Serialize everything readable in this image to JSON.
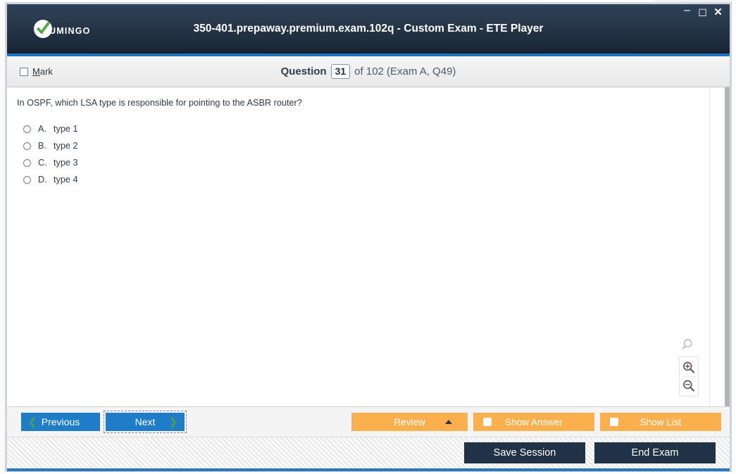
{
  "window": {
    "title": "350-401.prepaway.premium.exam.102q - Custom Exam - ETE Player",
    "controls": {
      "minimize": "–",
      "maximize": "☐",
      "close": "✕"
    }
  },
  "brand": {
    "name": "UMINGO",
    "check_color": "#4aa93a",
    "badge_color": "#ffffff"
  },
  "question_bar": {
    "mark_label_accel": "M",
    "mark_label_rest": "ark",
    "question_word": "Question",
    "question_number": "31",
    "rest": "of 102 (Exam A, Q49)"
  },
  "question": {
    "text": "In OSPF, which LSA type is responsible for pointing to the ASBR router?",
    "choices": [
      {
        "letter": "A.",
        "text": "type 1",
        "selected": false
      },
      {
        "letter": "B.",
        "text": "type 2",
        "selected": false
      },
      {
        "letter": "C.",
        "text": "type 3",
        "selected": false
      },
      {
        "letter": "D.",
        "text": "type 4",
        "selected": false
      }
    ]
  },
  "zoom_tools": {
    "search": "search-icon",
    "zoom_in": "zoom-in-icon",
    "zoom_out": "zoom-out-icon"
  },
  "toolbar": {
    "previous": "Previous",
    "next": "Next",
    "review": "Review",
    "show_answer": "Show Answer",
    "show_list": "Show List",
    "accent_blue": "#1f7cc8",
    "accent_orange": "#fbb04d",
    "chevron_green": "#4ca53b"
  },
  "footer": {
    "save_session": "Save Session",
    "end_exam": "End Exam",
    "button_color": "#203246",
    "accent_bar": "#2878c0"
  }
}
